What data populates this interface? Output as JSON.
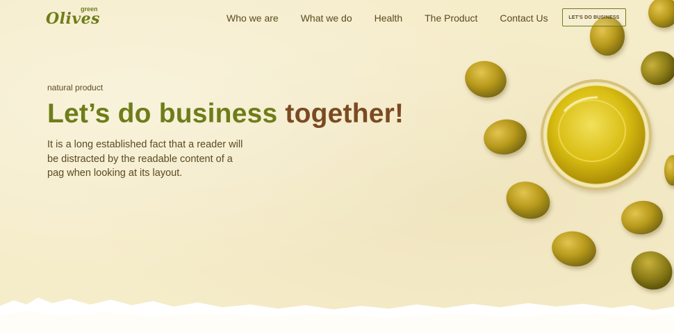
{
  "brand": {
    "logo_main": "Olives",
    "logo_small": "green"
  },
  "nav": {
    "items": [
      {
        "label": "Who we are"
      },
      {
        "label": "What we do"
      },
      {
        "label": "Health"
      },
      {
        "label": "The Product"
      },
      {
        "label": "Contact Us"
      }
    ],
    "cta_label": "LET'S DO BUSINESS"
  },
  "hero": {
    "eyebrow": "natural product",
    "headline_part1": "Let’s do business",
    "headline_part2": "together!",
    "description": "It is a long established fact that a reader will be distracted by the readable content of a pag when looking at its layout."
  },
  "colors": {
    "background": "#f5ecc9",
    "olive_green": "#6e7d19",
    "brown": "#7a4a22",
    "text": "#5a4a20"
  }
}
